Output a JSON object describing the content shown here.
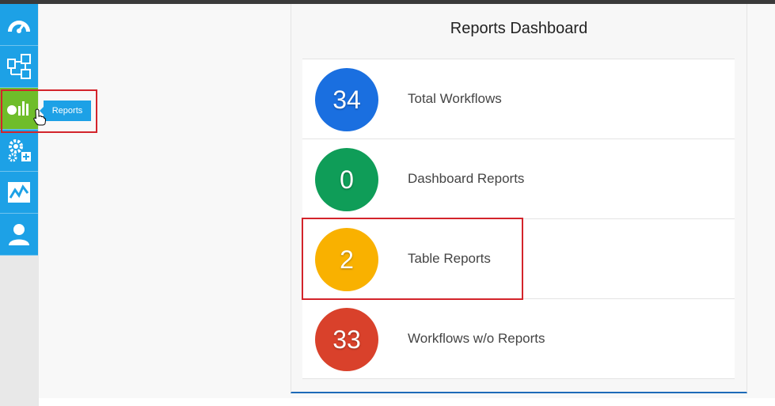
{
  "sidebar": {
    "items": [
      {
        "name": "dashboard",
        "icon": "speedometer-icon"
      },
      {
        "name": "workflows",
        "icon": "workflow-icon"
      },
      {
        "name": "reports",
        "icon": "reports-chart-icon",
        "active": true
      },
      {
        "name": "settings",
        "icon": "gears-add-icon"
      },
      {
        "name": "monitoring",
        "icon": "line-chart-icon"
      },
      {
        "name": "users",
        "icon": "user-icon"
      }
    ],
    "tooltip": "Reports"
  },
  "panel": {
    "title": "Reports Dashboard",
    "rows": [
      {
        "value": "34",
        "label": "Total Workflows",
        "color": "#1a6fe0"
      },
      {
        "value": "0",
        "label": "Dashboard Reports",
        "color": "#0f9d58"
      },
      {
        "value": "2",
        "label": "Table Reports",
        "color": "#f9b100"
      },
      {
        "value": "33",
        "label": "Workflows w/o Reports",
        "color": "#d9412b"
      }
    ]
  },
  "colors": {
    "sidebar_blue": "#1da1e6",
    "active_green": "#6fbd2a",
    "highlight_red": "#d3242b",
    "panel_bottom_blue": "#1e6bb8"
  }
}
